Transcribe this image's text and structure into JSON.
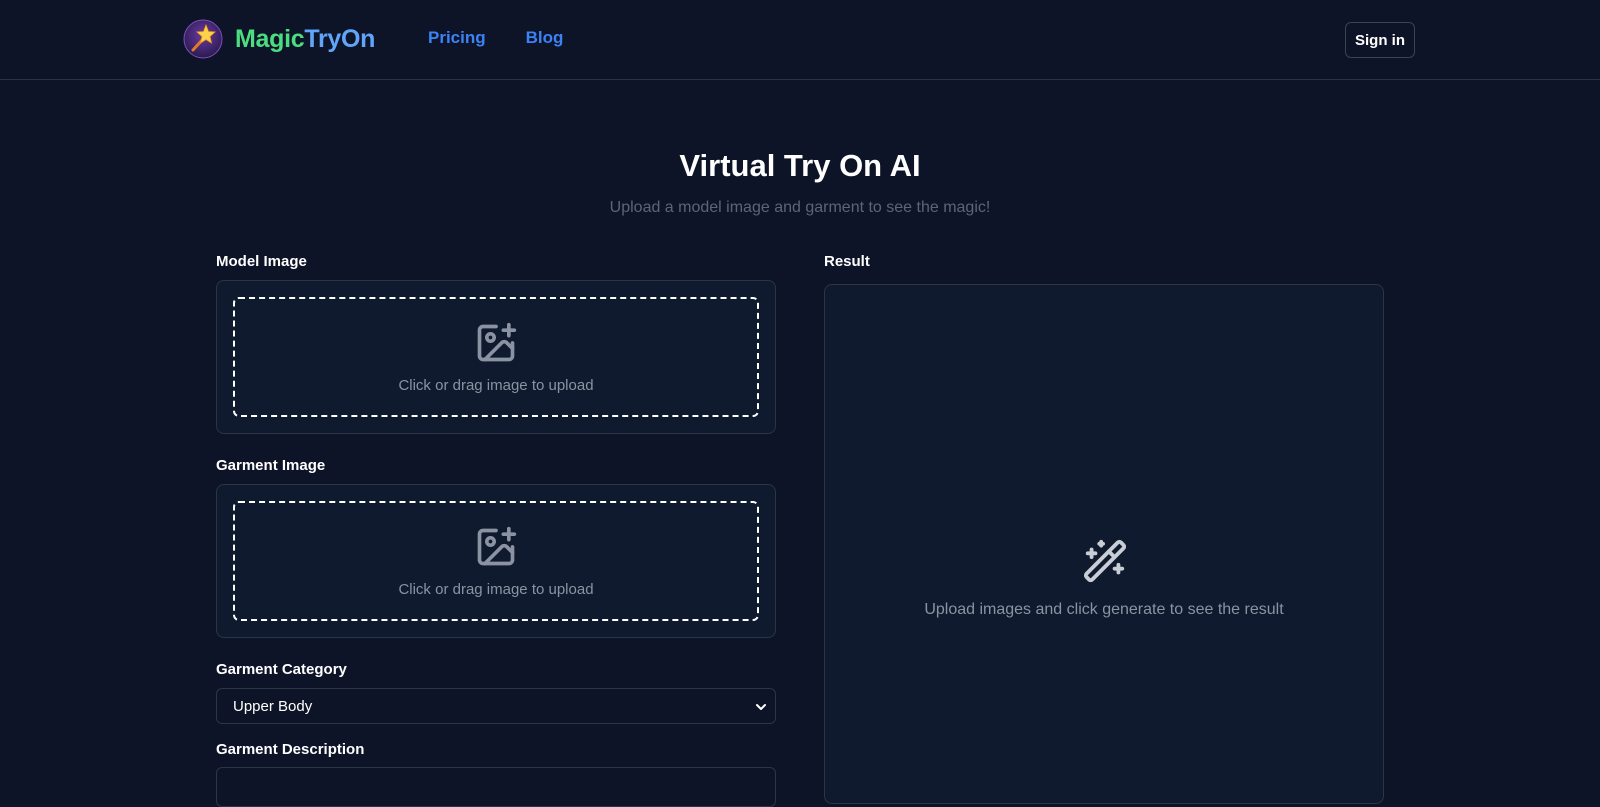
{
  "brand": {
    "name_part1": "Magic",
    "name_part2": "TryOn",
    "logo_icon": "magic-wand-star-icon"
  },
  "nav": {
    "items": [
      {
        "label": "Pricing"
      },
      {
        "label": "Blog"
      }
    ]
  },
  "header": {
    "sign_in_label": "Sign in"
  },
  "hero": {
    "title": "Virtual Try On AI",
    "subtitle": "Upload a model image and garment to see the magic!"
  },
  "model_image": {
    "label": "Model Image",
    "upload_text": "Click or drag image to upload",
    "icon": "image-plus-icon"
  },
  "garment_image": {
    "label": "Garment Image",
    "upload_text": "Click or drag image to upload",
    "icon": "image-plus-icon"
  },
  "garment_category": {
    "label": "Garment Category",
    "selected": "Upper Body"
  },
  "garment_description": {
    "label": "Garment Description"
  },
  "result": {
    "label": "Result",
    "placeholder_text": "Upload images and click generate to see the result",
    "icon": "magic-wand-icon"
  },
  "colors": {
    "background": "#0e1427",
    "panel": "#0f1a2e",
    "border": "#2b3548",
    "brand_green": "#4ade80",
    "brand_blue": "#60a5fa",
    "nav_link": "#3b82f6",
    "muted_text": "#8b93a3"
  }
}
